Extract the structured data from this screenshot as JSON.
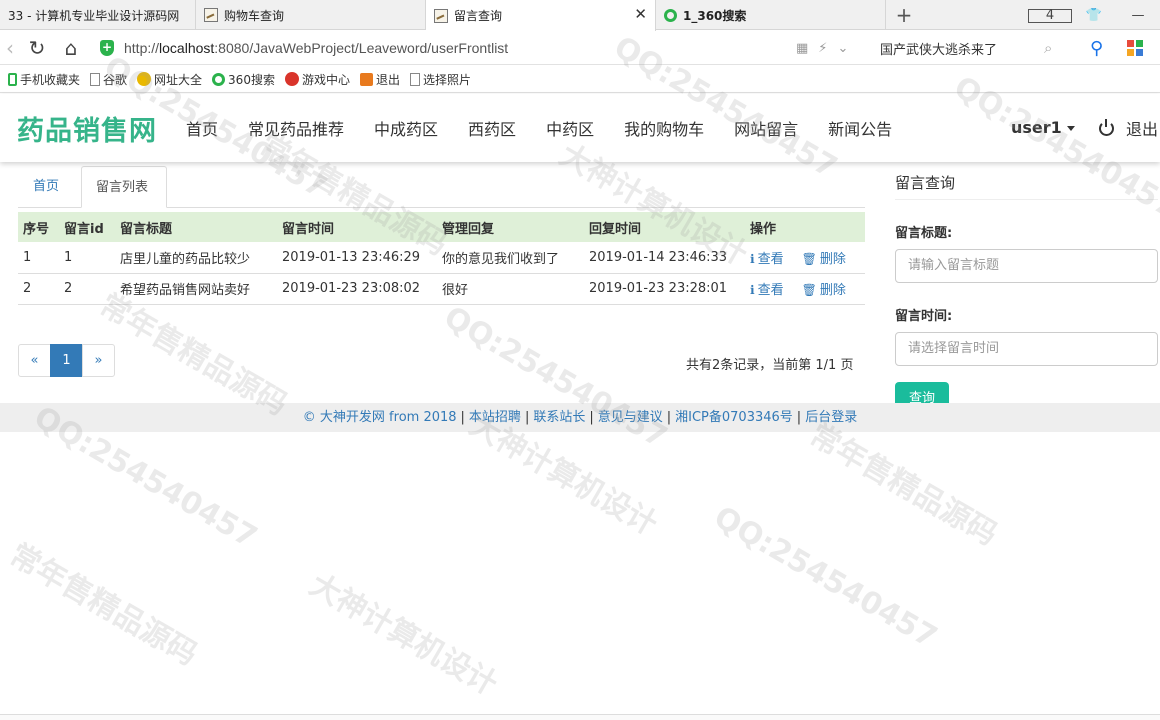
{
  "browser": {
    "tabs": [
      {
        "title": "33 - 计算机专业毕业设计源码网",
        "active": false
      },
      {
        "title": "购物车查询",
        "active": false
      },
      {
        "title": "留言查询",
        "active": true
      },
      {
        "title": "1_360搜索",
        "active": false
      }
    ],
    "tab_count": "4",
    "url_prefix": "http://",
    "url_host": "localhost",
    "url_path": ":8080/JavaWebProject/Leaveword/userFrontlist",
    "search_suggestion": "国产武侠大逃杀来了",
    "bookmarks": [
      "手机收藏夹",
      "谷歌",
      "网址大全",
      "360搜索",
      "游戏中心",
      "退出",
      "选择照片"
    ]
  },
  "site": {
    "brand": "药品销售网",
    "nav": [
      "首页",
      "常见药品推荐",
      "中成药区",
      "西药区",
      "中药区",
      "我的购物车",
      "网站留言",
      "新闻公告"
    ],
    "user": "user1",
    "logout": "退出"
  },
  "breadcrumb": {
    "home": "首页",
    "current": "留言列表"
  },
  "table": {
    "headers": [
      "序号",
      "留言id",
      "留言标题",
      "留言时间",
      "管理回复",
      "回复时间",
      "操作"
    ],
    "rows": [
      {
        "no": "1",
        "id": "1",
        "title": "店里儿童的药品比较少",
        "time": "2019-01-13 23:46:29",
        "reply": "你的意见我们收到了",
        "reply_time": "2019-01-14 23:46:33"
      },
      {
        "no": "2",
        "id": "2",
        "title": "希望药品销售网站卖好",
        "time": "2019-01-23 23:08:02",
        "reply": "很好",
        "reply_time": "2019-01-23 23:28:01"
      }
    ],
    "actions": {
      "view": "查看",
      "delete": "删除"
    }
  },
  "pager": {
    "prev": "«",
    "current": "1",
    "next": "»",
    "info": "共有2条记录，当前第 1/1 页"
  },
  "sidebar": {
    "title": "留言查询",
    "title_label": "留言标题:",
    "title_placeholder": "请输入留言标题",
    "time_label": "留言时间:",
    "time_placeholder": "请选择留言时间",
    "query_button": "查询"
  },
  "footer": {
    "links": [
      "© 大神开发网 from 2018",
      "本站招聘",
      "联系站长",
      "意见与建议",
      "湘ICP备0703346号",
      "后台登录"
    ]
  },
  "watermarks": [
    "QQ:254540457",
    "常年售精品源码",
    "大神计算机设计"
  ]
}
